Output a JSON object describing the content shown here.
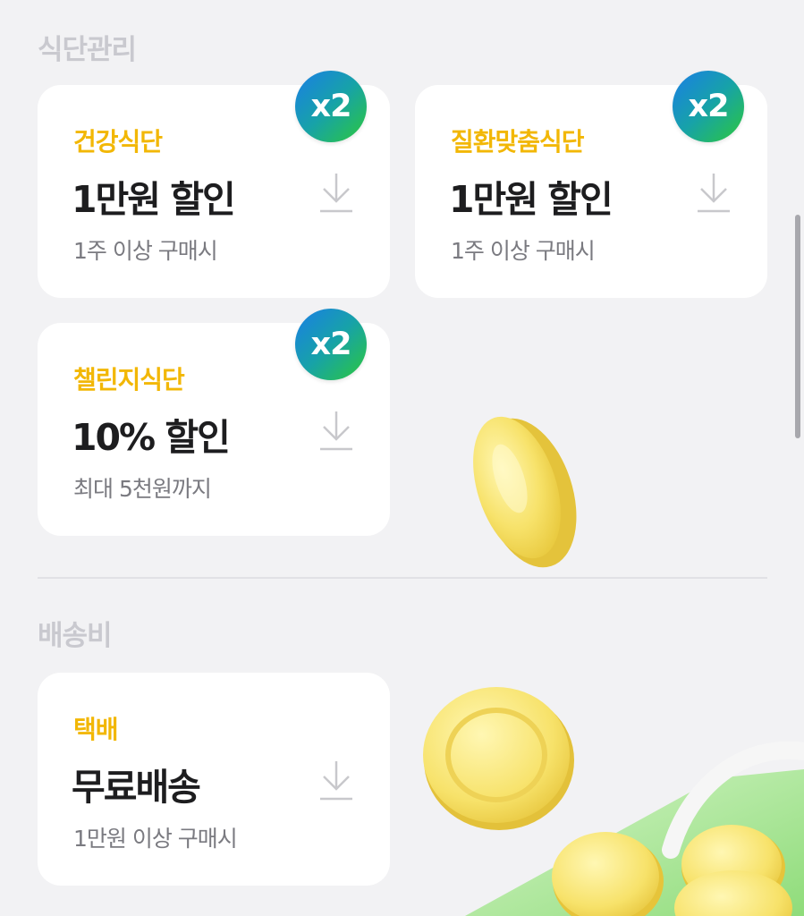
{
  "sections": [
    {
      "title": "식단관리",
      "coupons": [
        {
          "category": "건강식단",
          "benefit": "1만원 할인",
          "condition": "1주 이상 구매시",
          "badge": "x2"
        },
        {
          "category": "질환맞춤식단",
          "benefit": "1만원 할인",
          "condition": "1주 이상 구매시",
          "badge": "x2"
        },
        {
          "category": "챌린지식단",
          "benefit": "10% 할인",
          "condition": "최대 5천원까지",
          "badge": "x2"
        }
      ]
    },
    {
      "title": "배송비",
      "coupons": [
        {
          "category": "택배",
          "benefit": "무료배송",
          "condition": "1만원 이상 구매시"
        }
      ]
    }
  ],
  "icons": {
    "download": "download-icon",
    "badge": "x2-badge",
    "coin": "coin-illustration"
  },
  "colors": {
    "category_text": "#f2b705",
    "badge_gradient_start": "#1a7ee6",
    "badge_gradient_end": "#2cc83b",
    "section_title": "#c9c9cf",
    "background": "#f2f2f4"
  }
}
